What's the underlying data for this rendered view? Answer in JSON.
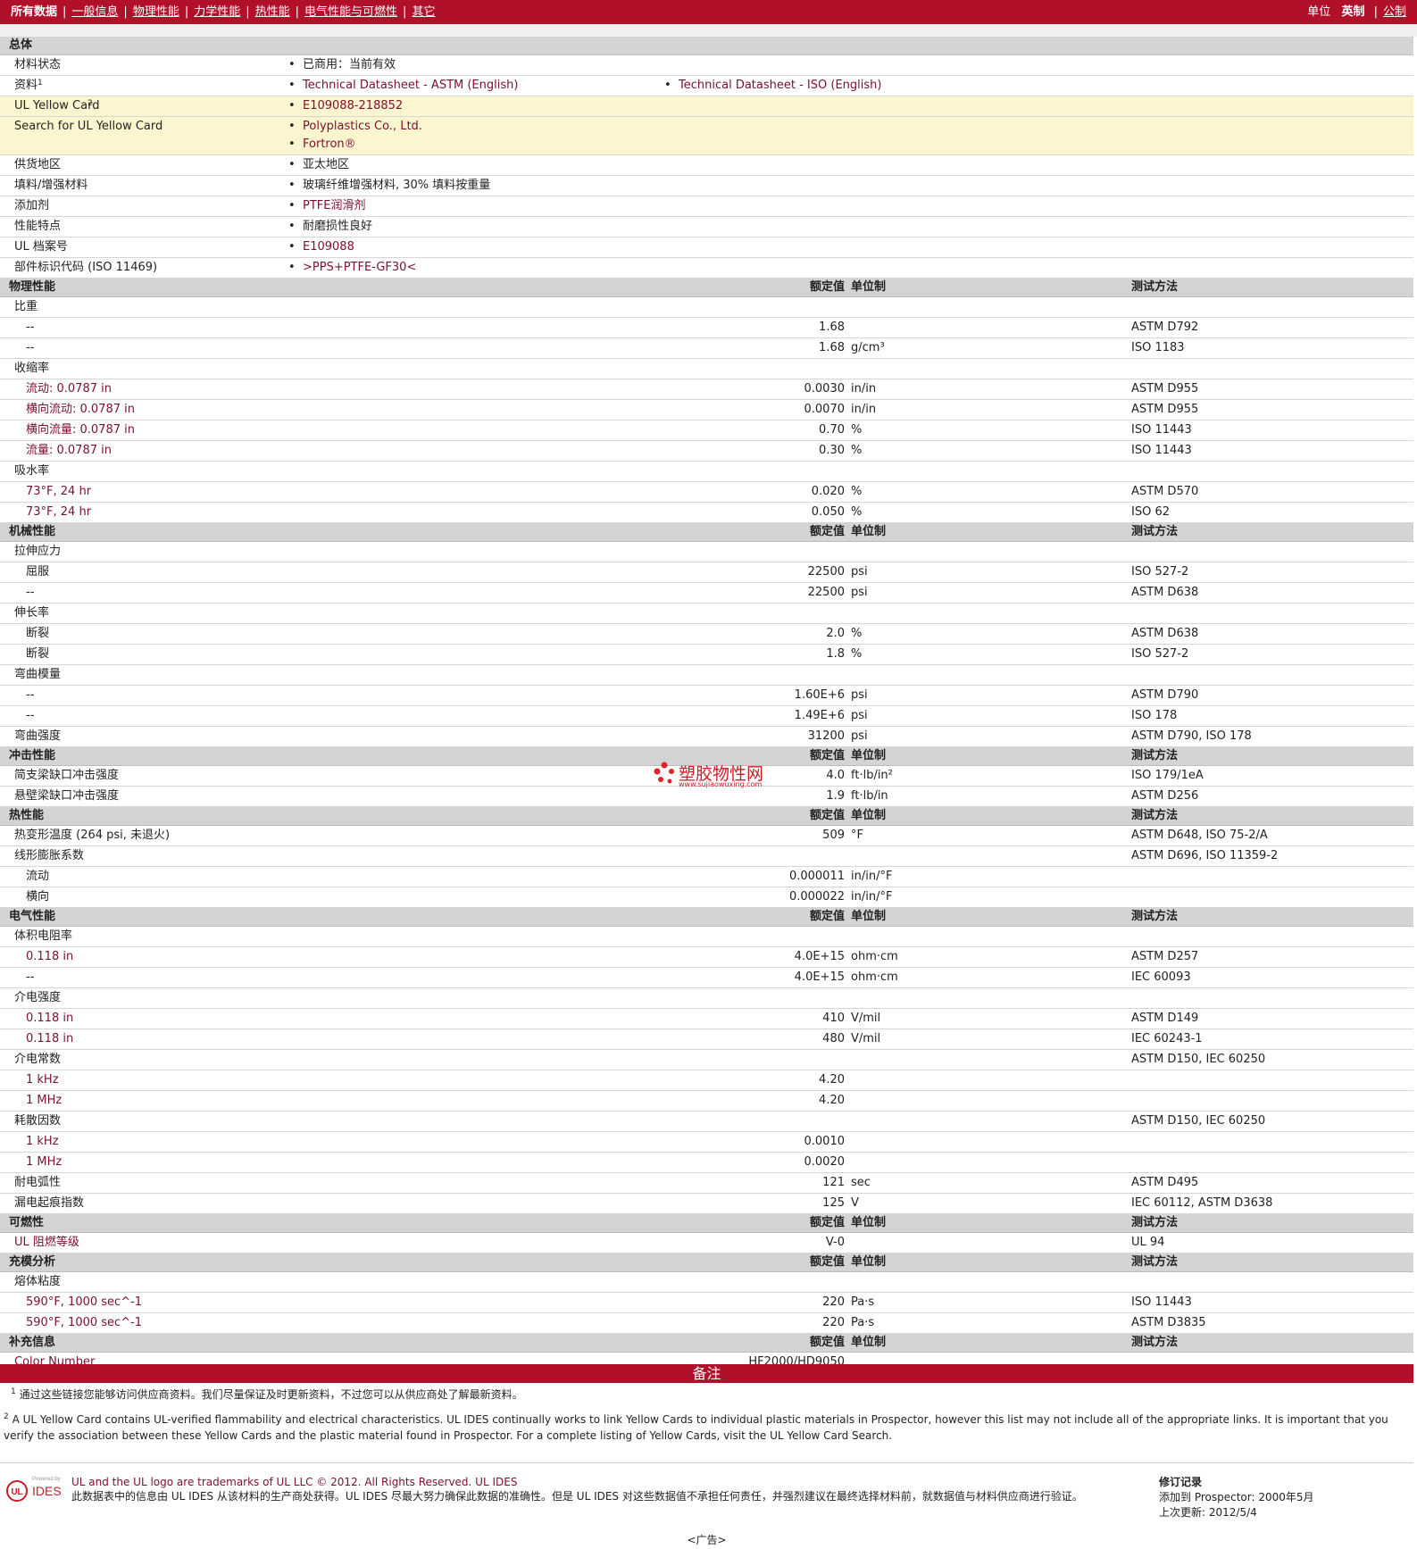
{
  "nav": {
    "items": [
      "所有数据",
      "一般信息",
      "物理性能",
      "力学性能",
      "热性能",
      "电气性能与可燃性",
      "其它"
    ],
    "units_label": "单位",
    "unit_current": "英制",
    "unit_alt": "公制"
  },
  "table_header": {
    "value": "额定值",
    "unit": "单位制",
    "test": "测试方法"
  },
  "general": {
    "title": "总体",
    "rows": [
      {
        "name": "材料状态",
        "b1": "已商用：当前有效"
      },
      {
        "name": "资料",
        "sup": "1",
        "b1": "Technical Datasheet - ASTM (English)",
        "b2": "Technical Datasheet - ISO (English)"
      },
      {
        "name": "UL Yellow Card",
        "sup": "2",
        "b1": "E109088-218852"
      },
      {
        "name": "Search for UL Yellow Card",
        "b1": "Polyplastics Co., Ltd.",
        "b1b": "Fortron®"
      },
      {
        "name": "供货地区",
        "b1": "亚太地区"
      },
      {
        "name": "填料/增强材料",
        "b1": "玻璃纤维增强材料, 30% 填料按重量"
      },
      {
        "name": "添加剂",
        "b1": "PTFE润滑剂"
      },
      {
        "name": "性能特点",
        "b1": "耐磨损性良好"
      },
      {
        "name": "UL 档案号",
        "b1": "E109088"
      },
      {
        "name": "部件标识代码 (ISO 11469)",
        "b1": ">PPS+PTFE-GF30<"
      }
    ]
  },
  "physical": {
    "title": "物理性能",
    "rows": [
      {
        "name": "比重"
      },
      {
        "name": "--",
        "sub": true,
        "value": "1.68",
        "unit": "",
        "test": "ASTM D792"
      },
      {
        "name": "--",
        "sub": true,
        "value": "1.68",
        "unit": "g/cm³",
        "test": "ISO 1183"
      },
      {
        "name": "收缩率"
      },
      {
        "name": "流动: 0.0787 in",
        "sub": true,
        "value": "0.0030",
        "unit": "in/in",
        "test": "ASTM D955"
      },
      {
        "name": "横向流动: 0.0787 in",
        "sub": true,
        "value": "0.0070",
        "unit": "in/in",
        "test": "ASTM D955"
      },
      {
        "name": "横向流量: 0.0787 in",
        "sub": true,
        "value": "0.70",
        "unit": "%",
        "test": "ISO 11443"
      },
      {
        "name": "流量: 0.0787 in",
        "sub": true,
        "value": "0.30",
        "unit": "%",
        "test": "ISO 11443"
      },
      {
        "name": "吸水率"
      },
      {
        "name": "73°F, 24 hr",
        "sub": true,
        "value": "0.020",
        "unit": "%",
        "test": "ASTM D570"
      },
      {
        "name": "73°F, 24 hr",
        "sub": true,
        "value": "0.050",
        "unit": "%",
        "test": "ISO 62"
      }
    ]
  },
  "mechanical": {
    "title": "机械性能",
    "rows": [
      {
        "name": "拉伸应力"
      },
      {
        "name": "屈服",
        "sub": true,
        "value": "22500",
        "unit": "psi",
        "test": "ISO 527-2"
      },
      {
        "name": "--",
        "sub": true,
        "value": "22500",
        "unit": "psi",
        "test": "ASTM D638"
      },
      {
        "name": "伸长率"
      },
      {
        "name": "断裂",
        "sub": true,
        "value": "2.0",
        "unit": "%",
        "test": "ASTM D638"
      },
      {
        "name": "断裂",
        "sub": true,
        "value": "1.8",
        "unit": "%",
        "test": "ISO 527-2"
      },
      {
        "name": "弯曲模量"
      },
      {
        "name": "--",
        "sub": true,
        "value": "1.60E+6",
        "unit": "psi",
        "test": "ASTM D790"
      },
      {
        "name": "--",
        "sub": true,
        "value": "1.49E+6",
        "unit": "psi",
        "test": "ISO 178"
      },
      {
        "name": "弯曲强度",
        "value": "31200",
        "unit": "psi",
        "test": "ASTM D790, ISO 178"
      }
    ]
  },
  "impact": {
    "title": "冲击性能",
    "rows": [
      {
        "name": "简支梁缺口冲击强度",
        "value": "4.0",
        "unit": "ft·lb/in²",
        "test": "ISO 179/1eA"
      },
      {
        "name": "悬壁梁缺口冲击强度",
        "value": "1.9",
        "unit": "ft·lb/in",
        "test": "ASTM D256"
      }
    ]
  },
  "thermal": {
    "title": "热性能",
    "rows": [
      {
        "name": "热变形温度 (264 psi, 未退火)",
        "value": "509",
        "unit": "°F",
        "test": "ASTM D648, ISO 75-2/A"
      },
      {
        "name": "线形膨胀系数",
        "test": "ASTM D696, ISO 11359-2"
      },
      {
        "name": "流动",
        "sub": true,
        "value": "0.000011",
        "unit": "in/in/°F"
      },
      {
        "name": "横向",
        "sub": true,
        "value": "0.000022",
        "unit": "in/in/°F"
      }
    ]
  },
  "electrical": {
    "title": "电气性能",
    "rows": [
      {
        "name": "体积电阻率"
      },
      {
        "name": "0.118 in",
        "sub": true,
        "value": "4.0E+15",
        "unit": "ohm·cm",
        "test": "ASTM D257"
      },
      {
        "name": "--",
        "sub": true,
        "value": "4.0E+15",
        "unit": "ohm·cm",
        "test": "IEC 60093"
      },
      {
        "name": "介电强度"
      },
      {
        "name": "0.118 in",
        "sub": true,
        "value": "410",
        "unit": "V/mil",
        "test": "ASTM D149"
      },
      {
        "name": "0.118 in",
        "sub": true,
        "value": "480",
        "unit": "V/mil",
        "test": "IEC 60243-1"
      },
      {
        "name": "介电常数",
        "test": "ASTM D150, IEC 60250"
      },
      {
        "name": "1 kHz",
        "sub": true,
        "value": "4.20"
      },
      {
        "name": "1 MHz",
        "sub": true,
        "value": "4.20"
      },
      {
        "name": "耗散因数",
        "test": "ASTM D150, IEC 60250"
      },
      {
        "name": "1 kHz",
        "sub": true,
        "value": "0.0010"
      },
      {
        "name": "1 MHz",
        "sub": true,
        "value": "0.0020"
      },
      {
        "name": "耐电弧性",
        "value": "121",
        "unit": "sec",
        "test": "ASTM D495"
      },
      {
        "name": "漏电起痕指数",
        "value": "125",
        "unit": "V",
        "test": "IEC 60112, ASTM D3638"
      }
    ]
  },
  "flammability": {
    "title": "可燃性",
    "rows": [
      {
        "name": "UL 阻燃等级",
        "value": "V-0",
        "test": "UL 94"
      }
    ]
  },
  "fill": {
    "title": "充模分析",
    "rows": [
      {
        "name": "熔体粘度"
      },
      {
        "name": "590°F, 1000 sec^-1",
        "sub": true,
        "value": "220",
        "unit": "Pa·s",
        "test": "ISO 11443"
      },
      {
        "name": "590°F, 1000 sec^-1",
        "sub": true,
        "value": "220",
        "unit": "Pa·s",
        "test": "ASTM D3835"
      }
    ]
  },
  "supplement": {
    "title": "补充信息",
    "rows": [
      {
        "name": "Color Number",
        "value": "HF2000/HD9050"
      }
    ]
  },
  "notes": {
    "title": "备注",
    "n1_sup": "1",
    "n1": "通过这些链接您能够访问供应商资料。我们尽量保证及时更新资料，不过您可以从供应商处了解最新资料。",
    "n2_sup": "2",
    "n2": "A UL Yellow Card contains UL-verified flammability and electrical characteristics. UL IDES continually works to link Yellow Cards to individual plastic materials in Prospector, however this list may not include all of the appropriate links. It is important that you verify the association between these Yellow Cards and the plastic material found in Prospector. For a complete listing of Yellow Cards, visit the UL Yellow Card Search."
  },
  "footer": {
    "logo_small": "Powered by",
    "logo_text": "IDES",
    "line1": "UL and the UL logo are trademarks of UL LLC © 2012. All Rights Reserved. UL IDES",
    "line2": "此数据表中的信息由 UL IDES 从该材料的生产商处获得。UL IDES 尽最大努力确保此数据的准确性。但是 UL IDES 对这些数据值不承担任何责任，并强烈建议在最终选择材料前，就数据值与材料供应商进行验证。",
    "rev_title": "修订记录",
    "rev_added": "添加到 Prospector: 2000年5月",
    "rev_updated": "上次更新: 2012/5/4",
    "ad": "<广告>"
  },
  "watermark": {
    "text": "塑胶物性网",
    "url": "www.sujiaowuxing.com"
  }
}
